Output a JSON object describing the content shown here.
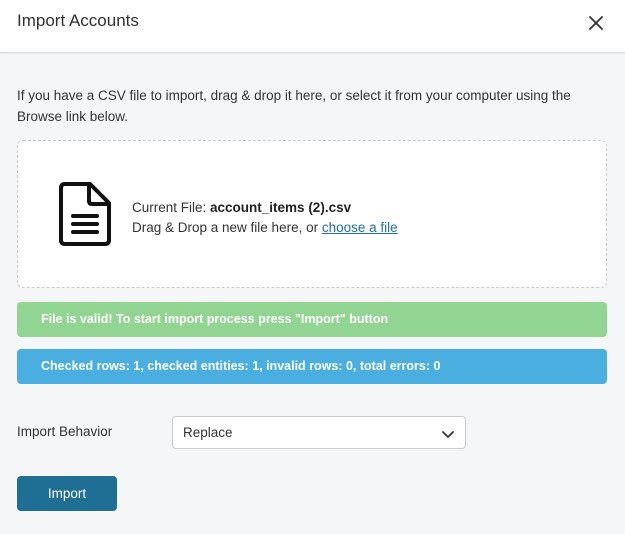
{
  "modal": {
    "title": "Import Accounts",
    "close_icon": "close-icon"
  },
  "intro_text": "If you have a CSV file to import, drag & drop it here, or select it from your computer using the Browse link below.",
  "dropzone": {
    "icon": "document-icon",
    "current_file_label": "Current File: ",
    "current_file_name": "account_items (2).csv",
    "drag_text": "Drag & Drop a new file here, or ",
    "choose_link": "choose a file"
  },
  "banners": {
    "success": "File is valid! To start import process press \"Import\" button",
    "info": "Checked rows: 1, checked entities: 1, invalid rows: 0, total errors: 0"
  },
  "import_behavior": {
    "label": "Import Behavior",
    "selected": "Replace"
  },
  "actions": {
    "import_label": "Import"
  },
  "colors": {
    "success_banner": "#92d492",
    "info_banner": "#4aafe0",
    "primary_button": "#1f6e94",
    "link": "#1f6fa3"
  }
}
